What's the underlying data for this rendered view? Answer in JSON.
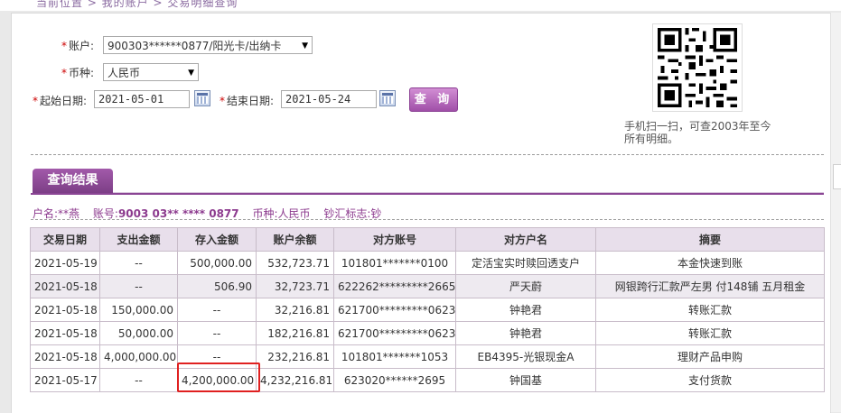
{
  "top_strip": {
    "text": "当前位置 > 我的账户 > 交易明细查询"
  },
  "query_form": {
    "account_label": "账户:",
    "account_value": "900303******0877/阳光卡/出纳卡",
    "currency_label": "币种:",
    "currency_value": "人民币",
    "start_label": "起始日期:",
    "start_value": "2021-05-01",
    "end_label": "结束日期:",
    "end_value": "2021-05-24",
    "query_button": "查 询",
    "required_mark": "*"
  },
  "qr": {
    "caption": "手机扫一扫，可查2003年至今所有明细。"
  },
  "results": {
    "tab_label": "查询结果",
    "info": {
      "name_label": "户名:",
      "name_value": "**燕",
      "acct_label": "账号:",
      "acct_value": "9003 03** **** 0877",
      "currency_label": "币种:",
      "currency_value": "人民币",
      "cash_label": "钞汇标志:",
      "cash_value": "钞"
    },
    "columns": [
      "交易日期",
      "支出金额",
      "存入金额",
      "账户余额",
      "对方账号",
      "对方户名",
      "摘要"
    ],
    "rows": [
      [
        "2021-05-19",
        "--",
        "500,000.00",
        "532,723.71",
        "101801*******0100",
        "定活宝实时赎回透支户",
        "本金快速到账"
      ],
      [
        "2021-05-18",
        "--",
        "506.90",
        "32,723.71",
        "622262*********2665",
        "严天蔚",
        "网银跨行汇款严左男 付148铺 五月租金"
      ],
      [
        "2021-05-18",
        "150,000.00",
        "--",
        "32,216.81",
        "621700*********0623",
        "钟艳君",
        "转账汇款"
      ],
      [
        "2021-05-18",
        "50,000.00",
        "--",
        "182,216.81",
        "621700*********0623",
        "钟艳君",
        "转账汇款"
      ],
      [
        "2021-05-18",
        "4,000,000.00",
        "--",
        "232,216.81",
        "101801*******1053",
        "EB4395-光银现金A",
        "理财产品申购"
      ],
      [
        "2021-05-17",
        "--",
        "4,200,000.00",
        "4,232,216.81",
        "623020******2695",
        "钟国基",
        "支付货款"
      ]
    ]
  },
  "colors": {
    "accent": "#8c3a8e",
    "tab": "#8a4594",
    "highlight": "#e02020"
  }
}
